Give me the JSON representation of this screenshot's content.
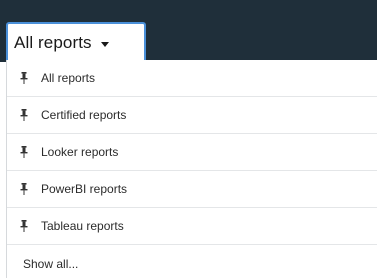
{
  "dropdown": {
    "label": "All reports",
    "caret_icon": "caret-down-icon"
  },
  "menu": {
    "items": [
      {
        "label": "All reports",
        "icon": "pin-icon"
      },
      {
        "label": "Certified reports",
        "icon": "pin-icon"
      },
      {
        "label": "Looker reports",
        "icon": "pin-icon"
      },
      {
        "label": "PowerBI reports",
        "icon": "pin-icon"
      },
      {
        "label": "Tableau reports",
        "icon": "pin-icon"
      }
    ],
    "show_all_label": "Show all..."
  },
  "colors": {
    "topbar": "#1f2f3a",
    "accent_border": "#4a90d9",
    "text": "#2b2b2b"
  }
}
